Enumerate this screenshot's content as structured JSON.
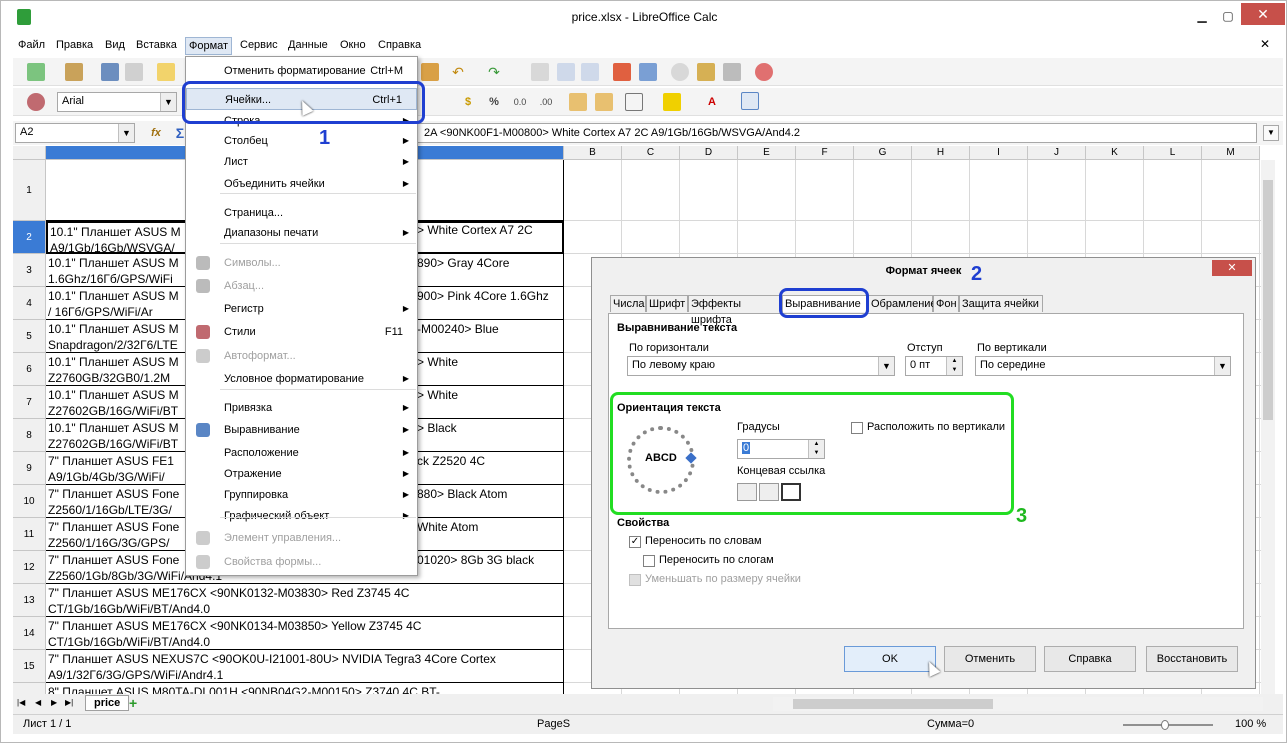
{
  "window": {
    "title": "price.xlsx - LibreOffice Calc",
    "minimize": "▁",
    "maximize": "▢",
    "close": "✕",
    "doc_close": "✕"
  },
  "menubar": [
    "Файл",
    "Правка",
    "Вид",
    "Вставка",
    "Формат",
    "Сервис",
    "Данные",
    "Окно",
    "Справка"
  ],
  "toolbar": {
    "font_name": "Arial"
  },
  "formula": {
    "cell_ref": "A2",
    "content": "2A <90NK00F1-M00800> White Cortex A7 2C A9/1Gb/16Gb/WSVGA/And4.2"
  },
  "columns": [
    "B",
    "C",
    "D",
    "E",
    "F",
    "G",
    "H",
    "I",
    "J",
    "K",
    "L",
    "M"
  ],
  "rows": [
    {
      "num": "1",
      "text": ""
    },
    {
      "num": "2",
      "text": "10.1\" Планшет ASUS M\nA9/1Gb/16Gb/WSVGA/"
    },
    {
      "num": "3",
      "text": "10.1\" Планшет ASUS M\n1.6Ghz/16Гб/GPS/WiFi"
    },
    {
      "num": "4",
      "text": "10.1\" Планшет ASUS M\n/ 16Гб/GPS/WiFi/Ar"
    },
    {
      "num": "5",
      "text": "10.1\" Планшет ASUS M\nSnapdragon/2/32Г6/LTE"
    },
    {
      "num": "6",
      "text": "10.1\" Планшет ASUS M\nZ2760GB/32GB0/1.2M"
    },
    {
      "num": "7",
      "text": "10.1\" Планшет ASUS M\nZ27602GB/16G/WiFi/BT"
    },
    {
      "num": "8",
      "text": "10.1\" Планшет ASUS M\nZ27602GB/16G/WiFi/BT"
    },
    {
      "num": "9",
      "text": "7\" Планшет ASUS FE1\nA9/1Gb/4Gb/3G/WiFi/"
    },
    {
      "num": "10",
      "text": "7\" Планшет ASUS Fone\nZ2560/1/16Gb/LTE/3G/"
    },
    {
      "num": "11",
      "text": "7\" Планшет ASUS Fone\nZ2560/1/16G/3G/GPS/"
    },
    {
      "num": "12",
      "text": "7\" Планшет ASUS Fone\nZ2560/1Gb/8Gb/3G/WiFi/And4.1"
    },
    {
      "num": "13",
      "text": "7\" Планшет ASUS ME176CX <90NK0132-M03830> Red Z3745 4C\nCT/1Gb/16Gb/WiFi/BT/And4.0"
    },
    {
      "num": "14",
      "text": "7\" Планшет ASUS ME176CX <90NK0134-M03850> Yellow Z3745 4C\nCT/1Gb/16Gb/WiFi/BT/And4.0"
    },
    {
      "num": "15",
      "text": "7\" Планшет ASUS NEXUS7C <90OK0U-I21001-80U> NVIDIA Tegra3 4Core Cortex\nA9/1/32Г6/3G/GPS/WiFi/Andr4.1"
    },
    {
      "num": "",
      "text": "8\" Планшет ASUS M80TA-DL001H <90NB04G2-M00150> Z3740 4C BT-"
    }
  ],
  "cell_tails": [
    {
      "row": "2",
      "text": "> White Cortex A7 2C"
    },
    {
      "row": "3",
      "text": "890> Gray 4Core"
    },
    {
      "row": "4",
      "text": "900> Pink 4Core 1.6Ghz"
    },
    {
      "row": "5",
      "text": "-M00240> Blue"
    },
    {
      "row": "6",
      "text": "> White"
    },
    {
      "row": "7",
      "text": "> White"
    },
    {
      "row": "8",
      "text": "> Black"
    },
    {
      "row": "9",
      "text": "ck Z2520 4C"
    },
    {
      "row": "10",
      "text": "880> Black Atom"
    },
    {
      "row": "11",
      "text": "White Atom"
    },
    {
      "row": "12",
      "text": "01020> 8Gb 3G black"
    }
  ],
  "format_menu": [
    {
      "label": "Отменить форматирование",
      "shortcut": "Ctrl+M"
    },
    {
      "label": "Ячейки...",
      "shortcut": "Ctrl+1"
    },
    {
      "label": "Строка",
      "arrow": true
    },
    {
      "label": "Столбец",
      "arrow": true
    },
    {
      "label": "Лист",
      "arrow": true
    },
    {
      "label": "Объединить ячейки",
      "arrow": true
    },
    {
      "label": "Страница..."
    },
    {
      "label": "Диапазоны печати",
      "arrow": true
    },
    {
      "label": "Символы...",
      "disabled": true
    },
    {
      "label": "Абзац...",
      "disabled": true
    },
    {
      "label": "Регистр",
      "arrow": true
    },
    {
      "label": "Стили",
      "shortcut": "F11"
    },
    {
      "label": "Автоформат...",
      "disabled": true
    },
    {
      "label": "Условное форматирование",
      "arrow": true
    },
    {
      "label": "Привязка",
      "arrow": true
    },
    {
      "label": "Выравнивание",
      "arrow": true
    },
    {
      "label": "Расположение",
      "arrow": true
    },
    {
      "label": "Отражение",
      "arrow": true
    },
    {
      "label": "Группировка",
      "arrow": true
    },
    {
      "label": "Графический объект",
      "arrow": true
    },
    {
      "label": "Элемент управления...",
      "disabled": true
    },
    {
      "label": "Свойства формы...",
      "disabled": true
    }
  ],
  "dialog": {
    "title": "Формат ячеек",
    "tabs": [
      "Числа",
      "Шрифт",
      "Эффекты шрифта",
      "Выравнивание",
      "Обрамление",
      "Фон",
      "Защита ячейки"
    ],
    "section_align": "Выравнивание текста",
    "horiz_label": "По горизонтали",
    "horiz_value": "По левому краю",
    "indent_label": "Отступ",
    "indent_value": "0 пт",
    "vert_label": "По вертикали",
    "vert_value": "По середине",
    "section_orient": "Ориентация текста",
    "degrees_label": "Градусы",
    "degrees_value": "0",
    "stack_label": "Расположить по вертикали",
    "ref_edge_label": "Концевая ссылка",
    "dial_text": "ABCD",
    "section_props": "Свойства",
    "wrap_words": "Переносить по словам",
    "hyphenate": "Переносить по слогам",
    "shrink": "Уменьшать по размеру ячейки",
    "buttons": {
      "ok": "OK",
      "cancel": "Отменить",
      "help": "Справка",
      "reset": "Восстановить"
    }
  },
  "annotations": [
    "1",
    "2",
    "3"
  ],
  "sheet_tab": "price",
  "status": {
    "sheet": "Лист 1 / 1",
    "page_style": "PageS",
    "sum": "Сумма=0",
    "zoom": "100 %"
  },
  "colors": {
    "highlight_blue": "#1f3fd1",
    "highlight_green": "#22dd22",
    "close_red": "#c7504a",
    "label_blue": "#1f3fd1",
    "label_green": "#1fb81f"
  }
}
